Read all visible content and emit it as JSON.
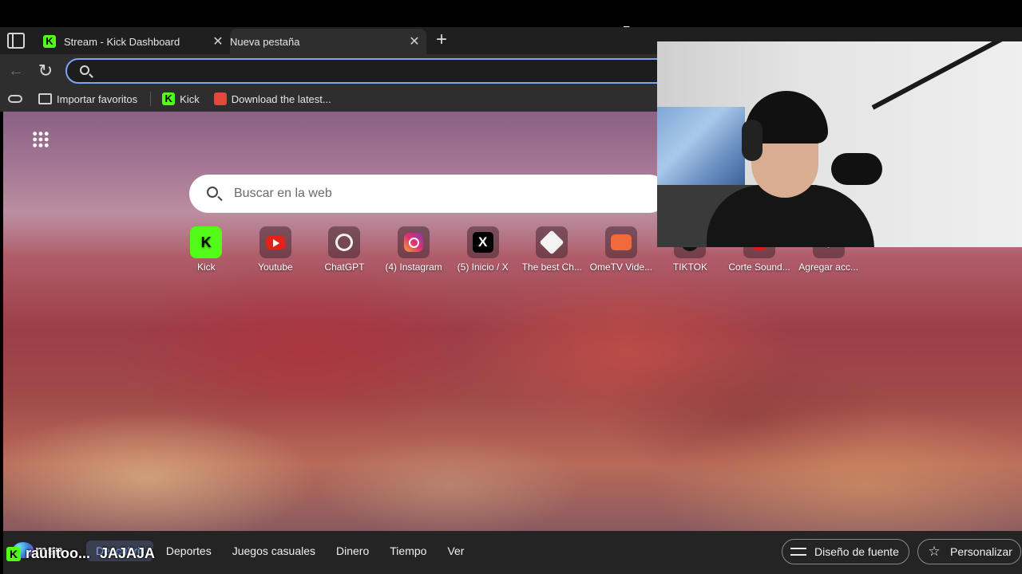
{
  "tabs": [
    {
      "title": "Stream - Kick Dashboard",
      "favicon": "kick-icon",
      "active": false
    },
    {
      "title": "Nueva pestaña",
      "favicon": "page-icon",
      "active": true
    }
  ],
  "tab_close_glyph": "✕",
  "new_tab_glyph": "+",
  "toolbar": {
    "back_glyph": "←",
    "reload_glyph": "↻",
    "address_value": ""
  },
  "bookmarks": [
    {
      "label": "Importar favoritos",
      "icon": "import-icon"
    },
    {
      "label": "Kick",
      "icon": "kick-icon"
    },
    {
      "label": "Download the latest...",
      "icon": "download-icon"
    }
  ],
  "newtab": {
    "search_placeholder": "Buscar en la web",
    "quick_links": [
      {
        "label": "Kick",
        "icon": "kick-icon",
        "glyph": "K"
      },
      {
        "label": "Youtube",
        "icon": "youtube-icon",
        "glyph": ""
      },
      {
        "label": "ChatGPT",
        "icon": "chatgpt-icon",
        "glyph": ""
      },
      {
        "label": "(4) Instagram",
        "icon": "instagram-icon",
        "glyph": ""
      },
      {
        "label": "(5) Inicio / X",
        "icon": "x-icon",
        "glyph": "X"
      },
      {
        "label": "The best Ch...",
        "icon": "chess-icon",
        "glyph": ""
      },
      {
        "label": "OmeTV Vide...",
        "icon": "ometv-icon",
        "glyph": ""
      },
      {
        "label": "TIKTOK",
        "icon": "tiktok-icon",
        "glyph": ""
      },
      {
        "label": "Corte Sound...",
        "icon": "soundcloud-icon",
        "glyph": ""
      },
      {
        "label": "Agregar acc...",
        "icon": "add-icon",
        "glyph": "+"
      }
    ]
  },
  "feed": {
    "brand": "msn",
    "tabs": [
      "Descubrir",
      "Deportes",
      "Juegos casuales",
      "Dinero",
      "Tiempo",
      "Ver"
    ],
    "active_tab": "Descubrir",
    "font_button": "Diseño de fuente",
    "personalize_button": "Personalizar"
  },
  "stream_overlay": {
    "username": "raulitoo...",
    "message": "JAJAJA",
    "badge": "K"
  },
  "colors": {
    "kick_green": "#53fc18",
    "focus_ring": "#7aa7f7",
    "active_feed_tab": "#7fa8ff"
  }
}
